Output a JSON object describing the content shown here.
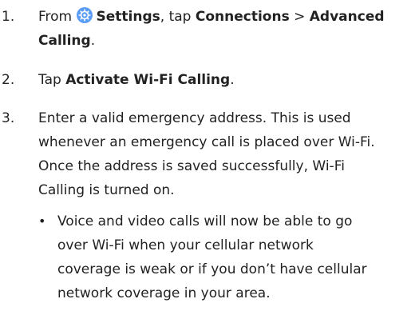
{
  "steps": [
    {
      "number": "1.",
      "from_text": "From ",
      "settings_icon": "gear-icon",
      "settings_label": "Settings",
      "tap_text": ", tap ",
      "connections_label": "Connections",
      "separator": " > ",
      "advanced_label": "Advanced",
      "calling_label": "Calling",
      "end_period": "."
    },
    {
      "number": "2.",
      "tap_text": "Tap ",
      "activate_label": "Activate Wi-Fi Calling",
      "end_period": "."
    },
    {
      "number": "3.",
      "lines": [
        "Enter a valid emergency address. This is used",
        "whenever an emergency call is placed over Wi-Fi.",
        "Once the address is saved successfully, Wi-Fi",
        "Calling is turned on."
      ]
    }
  ],
  "bullet": {
    "marker": "•",
    "lines": [
      "Voice and video calls will now be able to go",
      "over Wi-Fi when your cellular network",
      "coverage is weak or if you don’t have cellular",
      "network coverage in your area."
    ]
  },
  "colors": {
    "icon_bg": "#5a9cf5",
    "text": "#222222"
  }
}
